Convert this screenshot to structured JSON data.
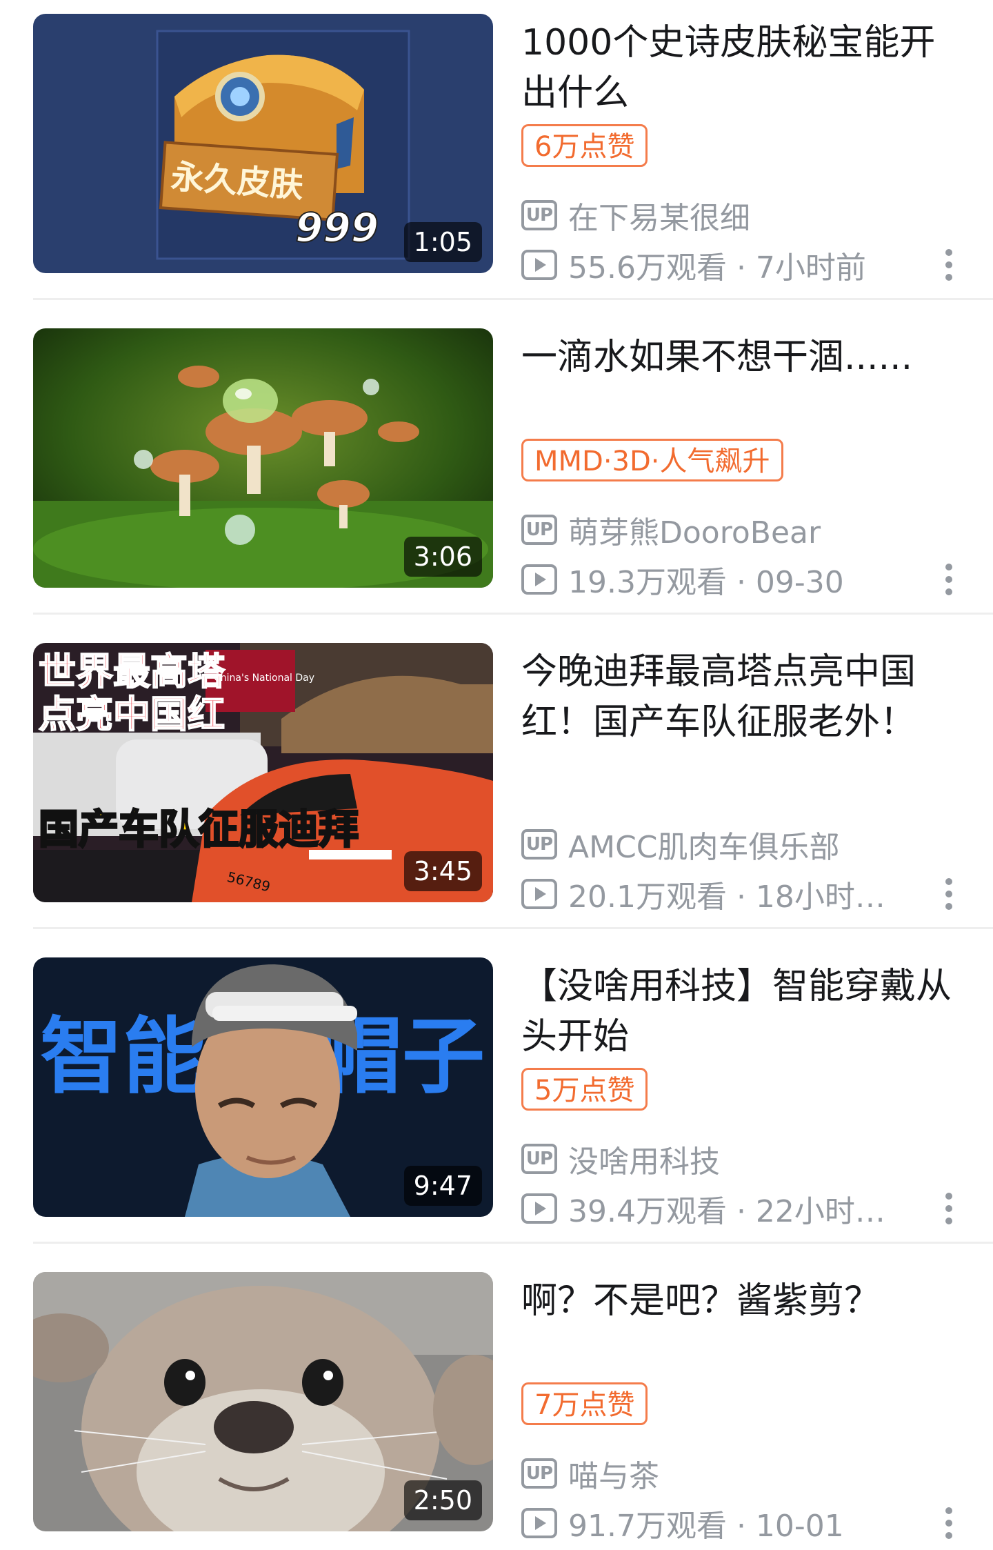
{
  "videos": [
    {
      "title": "1000个史诗皮肤秘宝能开出什么",
      "duration": "1:05",
      "tag": "6万点赞",
      "uploader": "在下易某很细",
      "views": "55.6万观看 · 7小时前",
      "thumb_text": [
        "永久皮肤",
        "999"
      ]
    },
    {
      "title": "一滴水如果不想干涸......",
      "duration": "3:06",
      "tag": "MMD·3D·人气飙升",
      "uploader": "萌芽熊DooroBear",
      "views": "19.3万观看 · 09-30"
    },
    {
      "title": "今晚迪拜最高塔点亮中国红！国产车队征服老外！",
      "duration": "3:45",
      "uploader": "AMCC肌肉车俱乐部",
      "views": "20.1万观看 · 18小时…",
      "thumb_text": [
        "世界最高塔",
        "点亮中国红",
        "国产车队征服迪拜",
        "China's National Day",
        "56789"
      ]
    },
    {
      "title": "【没啥用科技】智能穿戴从头开始",
      "duration": "9:47",
      "tag": "5万点赞",
      "uploader": "没啥用科技",
      "views": "39.4万观看 · 22小时…",
      "thumb_text": [
        "智能",
        "帽子"
      ]
    },
    {
      "title": "啊？不是吧？酱紫剪？",
      "duration": "2:50",
      "tag": "7万点赞",
      "uploader": "喵与茶",
      "views": "91.7万观看 · 10-01"
    }
  ],
  "icons": {
    "uploader": "up-icon",
    "views": "play-icon",
    "more": "more-vertical-icon"
  },
  "up_icon_label": "UP",
  "colors": {
    "tag": "#f26b2f",
    "meta": "#9499a0",
    "title": "#18191c"
  }
}
